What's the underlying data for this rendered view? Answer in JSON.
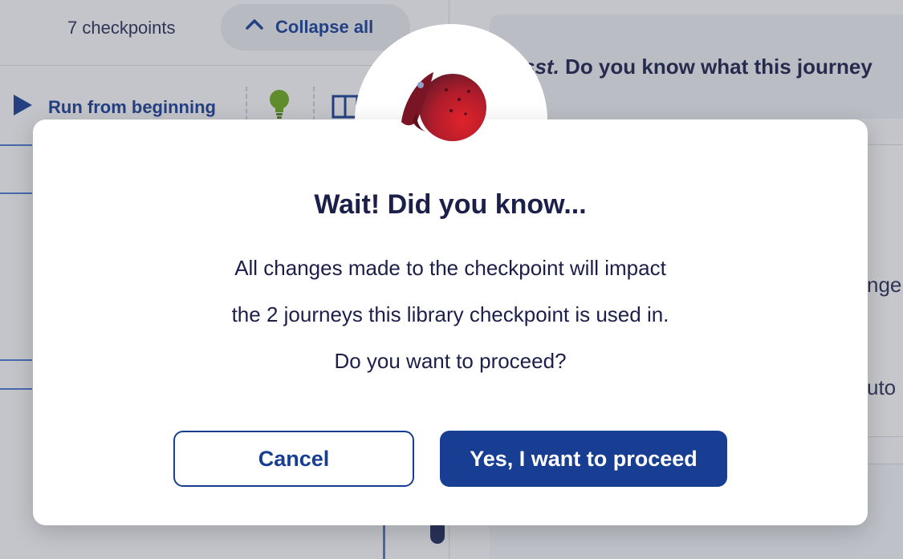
{
  "background": {
    "checkpoints_count": "7 checkpoints",
    "collapse_label": "Collapse all",
    "run_label": "Run from beginning",
    "tip_prefix": "sst.",
    "tip_text": " Do you know what this journey",
    "frag_changes": "nge",
    "frag_auto": "uto"
  },
  "modal": {
    "title": "Wait! Did you know...",
    "line1": "All changes made to the checkpoint will impact",
    "line2": "the 2 journeys this library checkpoint is used in.",
    "line3": "Do you want to proceed?",
    "cancel_label": "Cancel",
    "proceed_label": "Yes, I want to proceed"
  },
  "colors": {
    "primary": "#183e93",
    "heading": "#1b1f4a",
    "bulb": "#6aa81e",
    "planet_red": "#c81e2a"
  },
  "icons": [
    "chevron-up-icon",
    "play-icon",
    "lightbulb-icon",
    "split-view-icon",
    "planet-rocket-icon"
  ]
}
